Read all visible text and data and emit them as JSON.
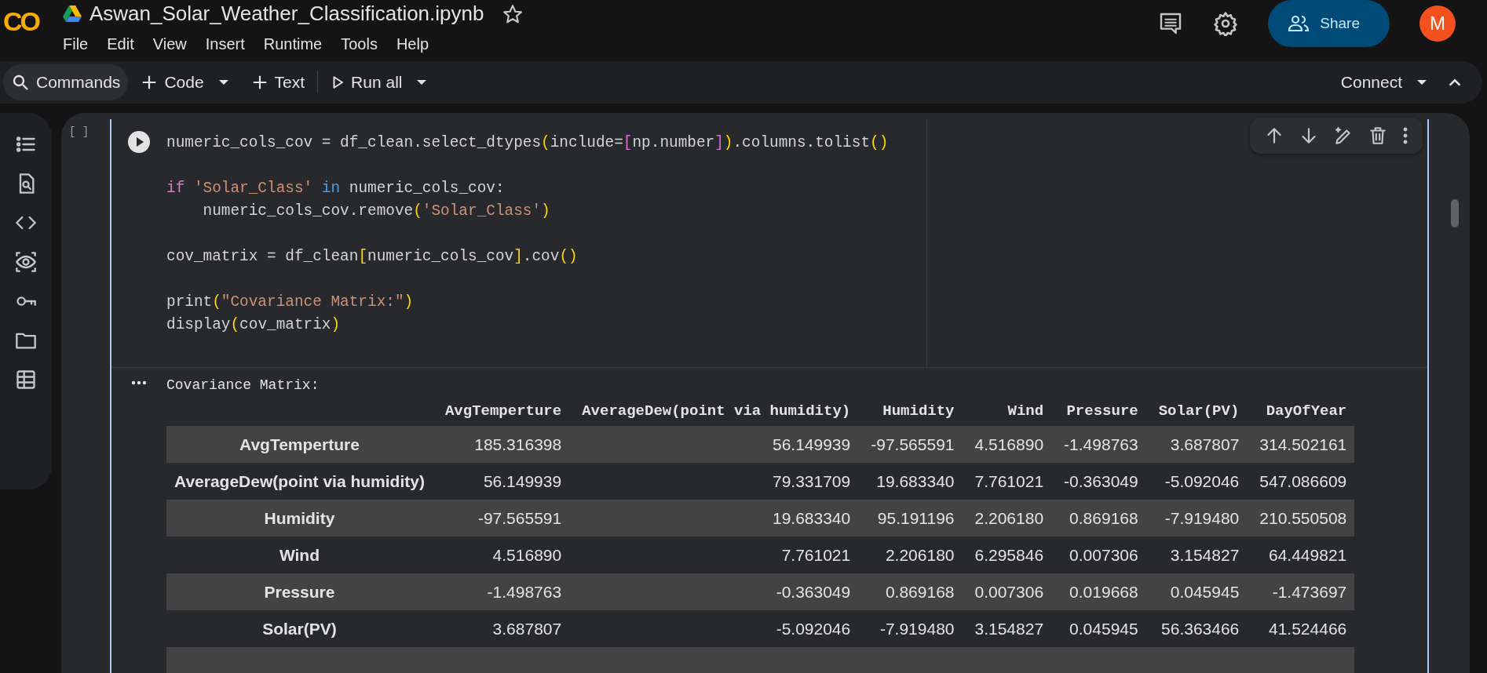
{
  "header": {
    "logo": "CO",
    "title": "Aswan_Solar_Weather_Classification.ipynb",
    "menu": [
      "File",
      "Edit",
      "View",
      "Insert",
      "Runtime",
      "Tools",
      "Help"
    ],
    "share": "Share",
    "avatar": "M"
  },
  "toolbar": {
    "commands": "Commands",
    "code": "Code",
    "text": "Text",
    "run_all": "Run all",
    "connect": "Connect"
  },
  "cell": {
    "execution_count": "[ ]",
    "code_lines": [
      {
        "kind": "code",
        "tokens": [
          {
            "text": "numeric_cols_cov = df_clean.select_dtypes",
            "kind": "plain"
          },
          {
            "text": "(",
            "kind": "bracket"
          },
          {
            "text": "include=",
            "kind": "plain"
          },
          {
            "text": "[",
            "kind": "bracket2"
          },
          {
            "text": "np.number",
            "kind": "plain"
          },
          {
            "text": "]",
            "kind": "bracket2"
          },
          {
            "text": ")",
            "kind": "bracket"
          },
          {
            "text": ".columns.tolist",
            "kind": "plain"
          },
          {
            "text": "()",
            "kind": "bracket"
          }
        ]
      },
      {
        "kind": "blank"
      },
      {
        "kind": "code",
        "tokens": [
          {
            "text": "if",
            "kind": "keyword"
          },
          {
            "text": " 'Solar_Class' ",
            "kind": "string"
          },
          {
            "text": "in",
            "kind": "operator"
          },
          {
            "text": " numeric_cols_cov:",
            "kind": "plain"
          }
        ]
      },
      {
        "kind": "code",
        "tokens": [
          {
            "text": "    numeric_cols_cov.remove",
            "kind": "plain"
          },
          {
            "text": "(",
            "kind": "bracket"
          },
          {
            "text": "'Solar_Class'",
            "kind": "string"
          },
          {
            "text": ")",
            "kind": "bracket"
          }
        ]
      },
      {
        "kind": "blank"
      },
      {
        "kind": "code",
        "tokens": [
          {
            "text": "cov_matrix = df_clean",
            "kind": "plain"
          },
          {
            "text": "[",
            "kind": "bracket"
          },
          {
            "text": "numeric_cols_cov",
            "kind": "plain"
          },
          {
            "text": "]",
            "kind": "bracket"
          },
          {
            "text": ".cov",
            "kind": "plain"
          },
          {
            "text": "()",
            "kind": "bracket"
          }
        ]
      },
      {
        "kind": "blank"
      },
      {
        "kind": "code",
        "tokens": [
          {
            "text": "print",
            "kind": "plain"
          },
          {
            "text": "(",
            "kind": "bracket"
          },
          {
            "text": "\"Covariance Matrix:\"",
            "kind": "string"
          },
          {
            "text": ")",
            "kind": "bracket"
          }
        ]
      },
      {
        "kind": "code",
        "tokens": [
          {
            "text": "display",
            "kind": "plain"
          },
          {
            "text": "(",
            "kind": "bracket"
          },
          {
            "text": "cov_matrix",
            "kind": "plain"
          },
          {
            "text": ")",
            "kind": "bracket"
          }
        ]
      }
    ]
  },
  "output": {
    "text": "Covariance Matrix:",
    "table": {
      "columns": [
        "AvgTemperture",
        "AverageDew(point via humidity)",
        "Humidity",
        "Wind",
        "Pressure",
        "Solar(PV)",
        "DayOfYear"
      ],
      "rows": [
        {
          "index": "AvgTemperture",
          "values": [
            "185.316398",
            "56.149939",
            "-97.565591",
            "4.516890",
            "-1.498763",
            "3.687807",
            "314.502161"
          ]
        },
        {
          "index": "AverageDew(point via humidity)",
          "values": [
            "56.149939",
            "79.331709",
            "19.683340",
            "7.761021",
            "-0.363049",
            "-5.092046",
            "547.086609"
          ]
        },
        {
          "index": "Humidity",
          "values": [
            "-97.565591",
            "19.683340",
            "95.191196",
            "2.206180",
            "0.869168",
            "-7.919480",
            "210.550508"
          ]
        },
        {
          "index": "Wind",
          "values": [
            "4.516890",
            "7.761021",
            "2.206180",
            "6.295846",
            "0.007306",
            "3.154827",
            "64.449821"
          ]
        },
        {
          "index": "Pressure",
          "values": [
            "-1.498763",
            "-0.363049",
            "0.869168",
            "0.007306",
            "0.019668",
            "0.045945",
            "-1.473697"
          ]
        },
        {
          "index": "Solar(PV)",
          "values": [
            "3.687807",
            "-5.092046",
            "-7.919480",
            "3.154827",
            "0.045945",
            "56.363466",
            "41.524466"
          ]
        }
      ]
    }
  }
}
